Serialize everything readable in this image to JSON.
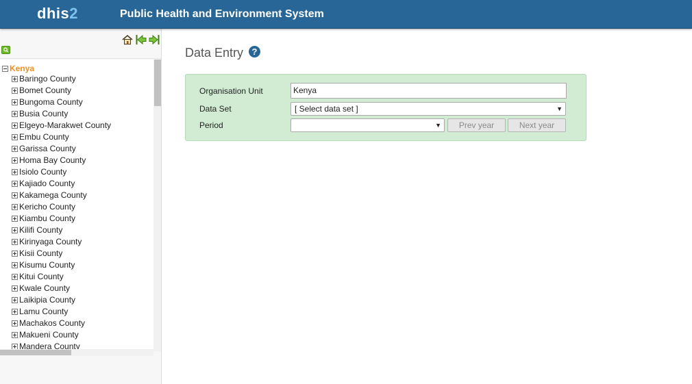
{
  "header": {
    "logo_main": "dhis",
    "logo_num": "2",
    "title": "Public Health and Environment System"
  },
  "tree": {
    "root": "Kenya",
    "items": [
      "Baringo County",
      "Bomet County",
      "Bungoma County",
      "Busia County",
      "Elgeyo-Marakwet County",
      "Embu County",
      "Garissa County",
      "Homa Bay County",
      "Isiolo County",
      "Kajiado County",
      "Kakamega County",
      "Kericho County",
      "Kiambu County",
      "Kilifi County",
      "Kirinyaga County",
      "Kisii County",
      "Kisumu County",
      "Kitui County",
      "Kwale County",
      "Laikipia County",
      "Lamu County",
      "Machakos County",
      "Makueni County",
      "Mandera County"
    ]
  },
  "main": {
    "title": "Data Entry",
    "help_glyph": "?"
  },
  "form": {
    "org_unit_label": "Organisation Unit",
    "org_unit_value": "Kenya",
    "dataset_label": "Data Set",
    "dataset_value": "[ Select data set ]",
    "period_label": "Period",
    "period_value": "",
    "prev_year": "Prev year",
    "next_year": "Next year",
    "arrow_glyph": "▼"
  },
  "icons": {
    "home": "home-icon",
    "back": "arrow-left-icon",
    "forward": "arrow-right-icon",
    "search": "search-icon",
    "help": "help-icon"
  },
  "colors": {
    "header_bg": "#276696",
    "form_bg": "#d1ecd3",
    "root_orange": "#ef8f1f",
    "search_green": "#6fb827"
  }
}
